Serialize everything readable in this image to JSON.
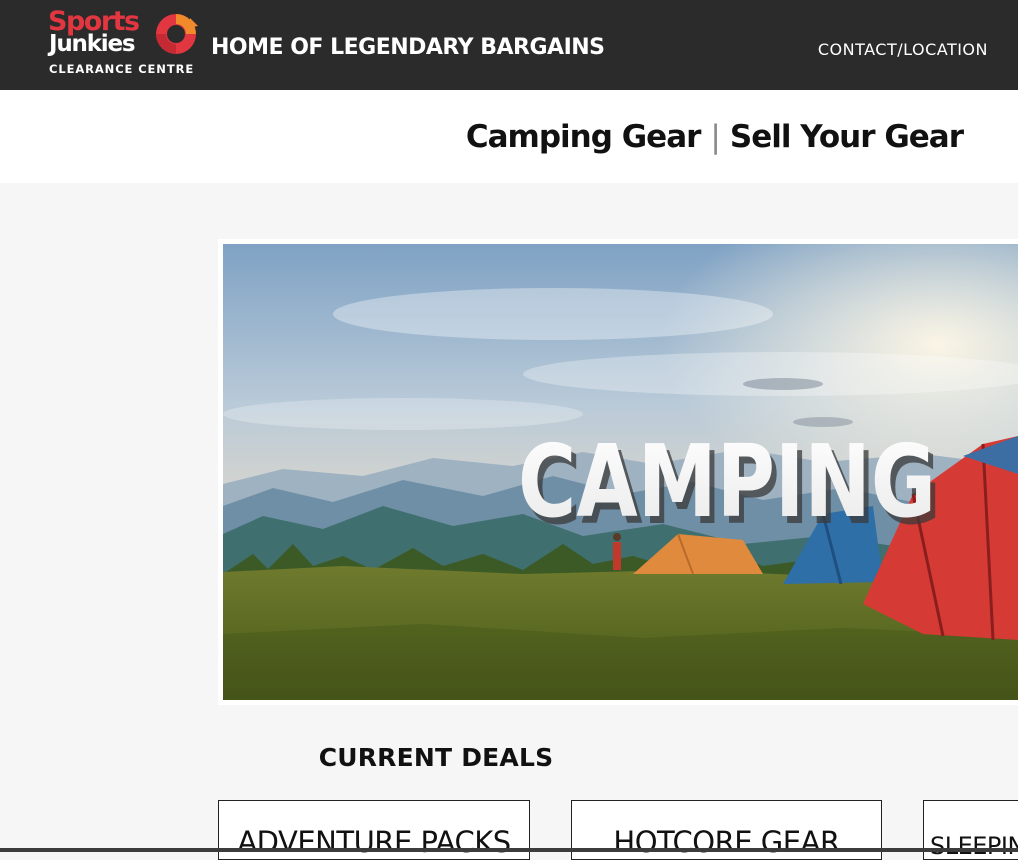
{
  "header": {
    "logo": {
      "word1": "Sports",
      "word2": "Junkies",
      "subtitle": "CLEARANCE CENTRE"
    },
    "tagline": "HOME OF LEGENDARY BARGAINS",
    "contact_label": "CONTACT/LOCATION",
    "colors": {
      "background": "#2b2b2b",
      "brand_red": "#e23640",
      "brand_orange": "#f08a2a"
    }
  },
  "subnav": {
    "links": [
      {
        "label": "Camping Gear"
      },
      {
        "label": "Sell Your Gear"
      }
    ],
    "separator": "|"
  },
  "hero": {
    "title": "CAMPING"
  },
  "deals": {
    "heading": "CURRENT DEALS",
    "items": [
      {
        "label": "ADVENTURE PACKS"
      },
      {
        "label": "HOTCORE GEAR"
      },
      {
        "label": "SLEEPING"
      }
    ]
  }
}
